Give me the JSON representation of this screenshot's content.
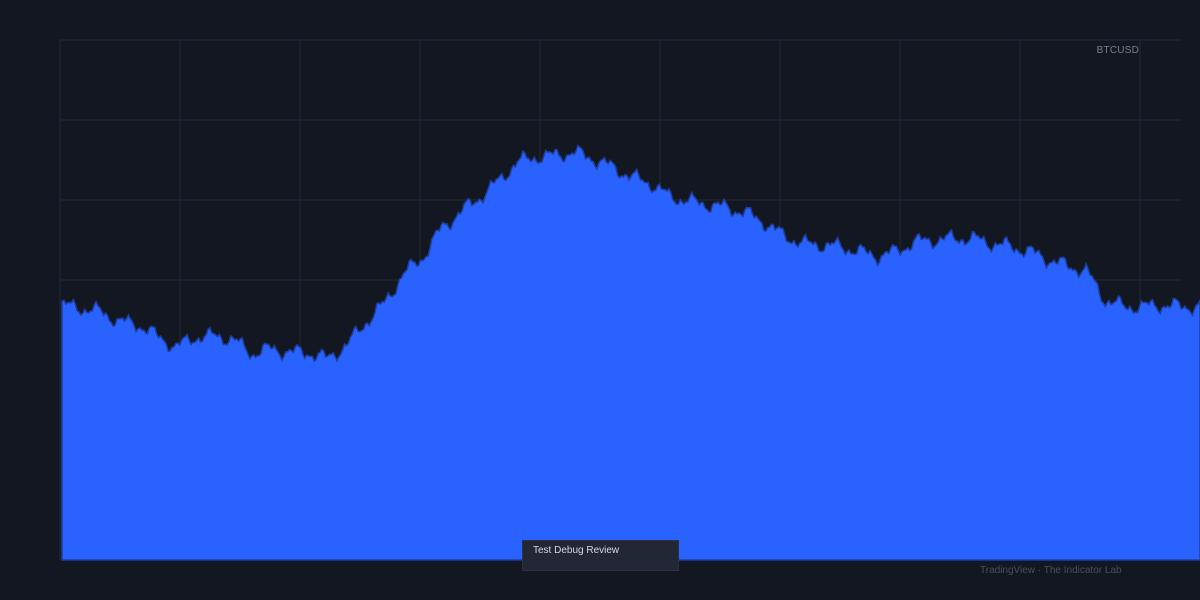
{
  "symbol": "BTCUSD",
  "tooltip_text": "Test Debug Review",
  "footer_text": "TradingView · The Indicator Lab",
  "colors": {
    "background": "#131722",
    "area_fill": "#2962ff",
    "area_outline": "#1e3f9e",
    "grid": "#242936"
  },
  "chart_data": {
    "type": "area",
    "title": "",
    "xlabel": "",
    "ylabel": "",
    "series": [
      {
        "name": "BTCUSD",
        "x": [
          0,
          20,
          40,
          60,
          80,
          100,
          120,
          140,
          160,
          180,
          200,
          220,
          240,
          260,
          280,
          300,
          320,
          340,
          360,
          380,
          400,
          420,
          440,
          460,
          480,
          500,
          520,
          540,
          560,
          580,
          600,
          620,
          640,
          660,
          680,
          700,
          720,
          740,
          760,
          780,
          800,
          820,
          840,
          860,
          880,
          900,
          920,
          940,
          960,
          980,
          1000,
          1020,
          1040,
          1060,
          1080,
          1100,
          1120,
          1140,
          1160,
          1180
        ],
        "values": [
          78.5,
          77.5,
          76.5,
          73.5,
          72.5,
          69.0,
          65.5,
          68.5,
          69.0,
          68.0,
          63.5,
          65.0,
          64.0,
          63.8,
          62.0,
          66.0,
          73.0,
          79.0,
          88.0,
          93.0,
          102.0,
          107.0,
          111.5,
          116.5,
          122.5,
          124.0,
          124.5,
          125.5,
          123.5,
          121.0,
          118.0,
          116.0,
          112.0,
          110.5,
          109.5,
          108.5,
          107.0,
          104.0,
          100.0,
          97.5,
          97.0,
          96.5,
          95.0,
          93.5,
          95.0,
          98.0,
          98.5,
          99.0,
          99.0,
          97.5,
          96.5,
          95.0,
          92.5,
          90.5,
          89.0,
          80.0,
          78.0,
          78.0,
          78.5,
          78.0
        ]
      }
    ],
    "ylim": [
      0,
      160
    ],
    "xlim": [
      0,
      1200
    ],
    "grid": true,
    "legend": "none"
  }
}
